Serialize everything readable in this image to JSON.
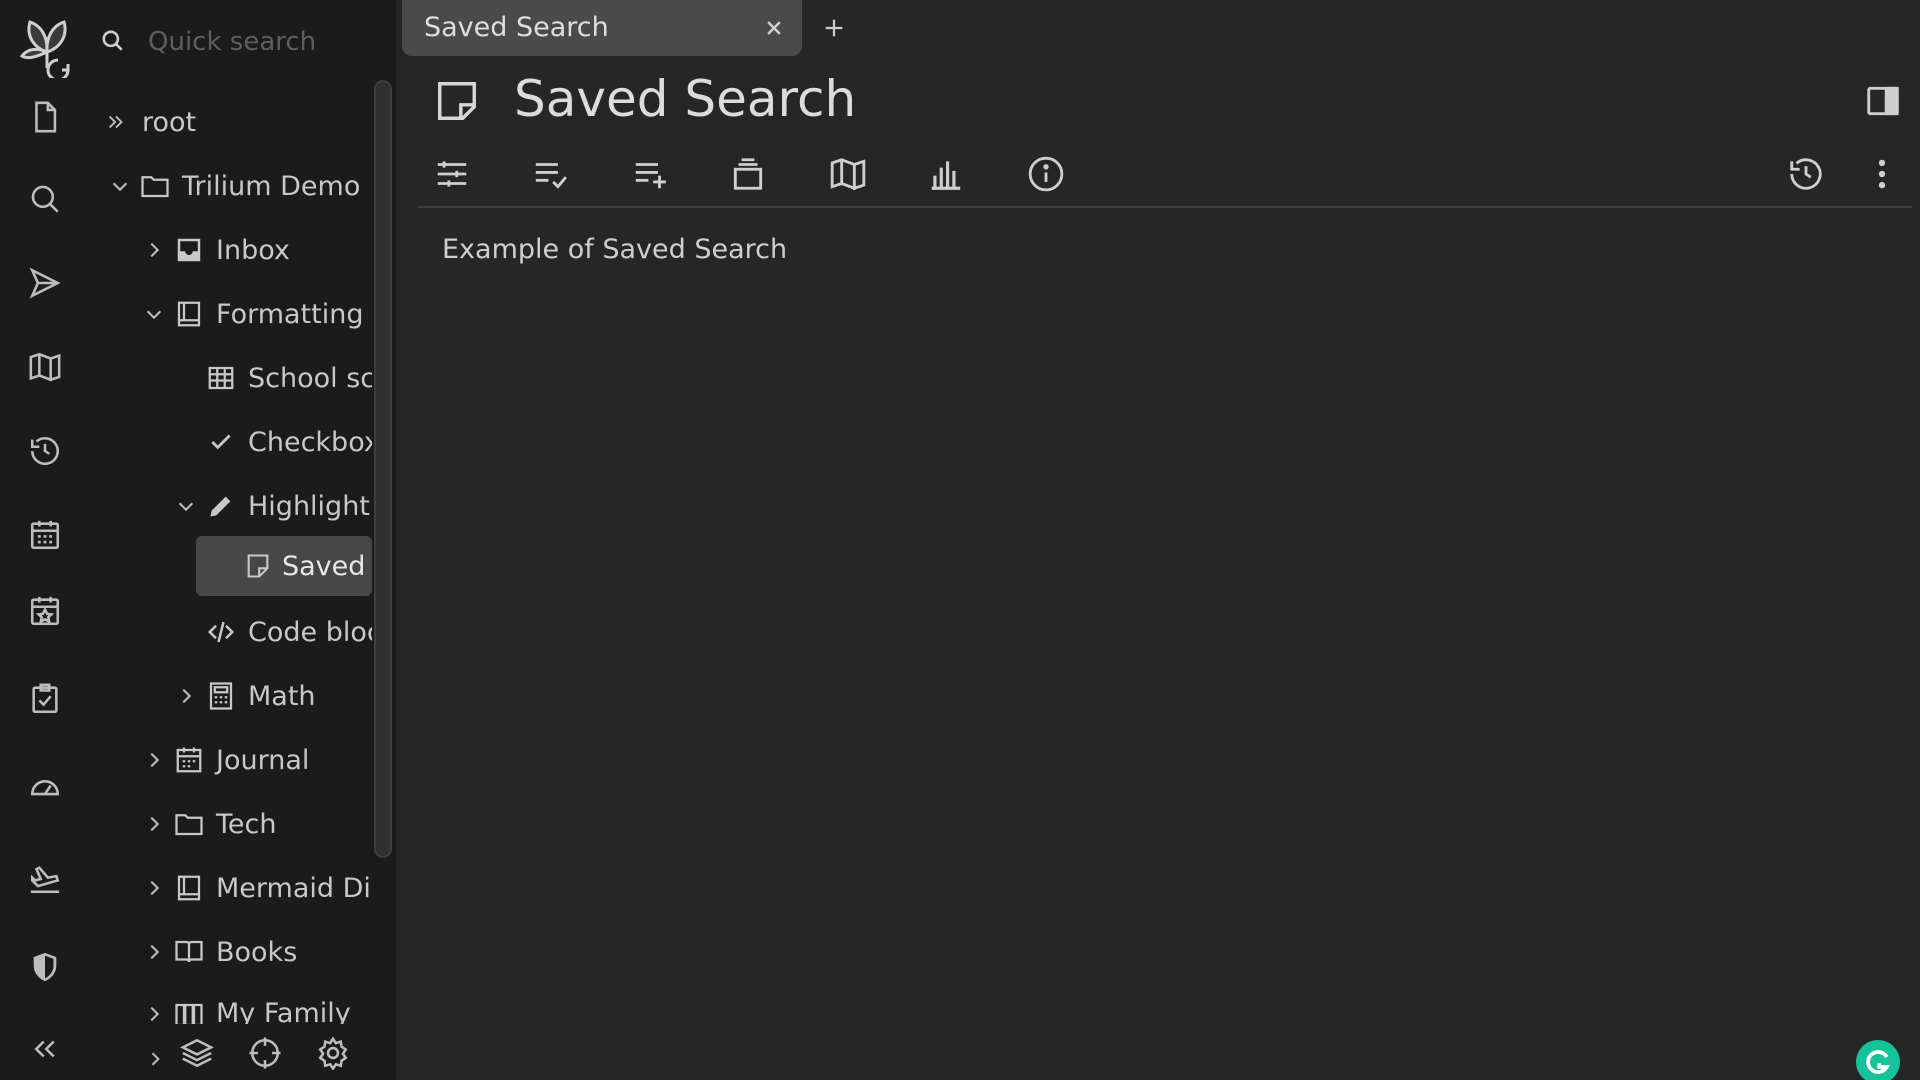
{
  "tree": {
    "search_placeholder": "Quick search",
    "root_label": "root",
    "nodes": [
      {
        "label": "Trilium Demo"
      },
      {
        "label": "Inbox"
      },
      {
        "label": "Formatting"
      },
      {
        "label": "School schedule"
      },
      {
        "label": "Checkbox"
      },
      {
        "label": "Highlighting"
      },
      {
        "label": "Saved Search"
      },
      {
        "label": "Code blocks"
      },
      {
        "label": "Math"
      },
      {
        "label": "Journal"
      },
      {
        "label": "Tech"
      },
      {
        "label": "Mermaid Diagrams"
      },
      {
        "label": "Books"
      },
      {
        "label": "My Family"
      }
    ]
  },
  "tab": {
    "title": "Saved Search"
  },
  "note": {
    "title": "Saved Search",
    "content": "Example of Saved Search"
  },
  "icons": {
    "launcher": [
      "new-note-icon",
      "search-icon",
      "send-icon",
      "map-icon",
      "history-icon",
      "calendar-icon",
      "calendar-star-icon",
      "task-icon",
      "dashboard-icon",
      "plane-icon",
      "shield-icon",
      "collapse-icon"
    ],
    "ribbon": [
      "options-icon",
      "search-params-icon",
      "add-list-icon",
      "stack-icon",
      "note-map-icon",
      "stats-icon",
      "info-icon"
    ]
  },
  "colors": {
    "background": "#262626",
    "sidebar": "#1b1b1b",
    "active_item": "#474747",
    "grammarly": "#15c39a"
  }
}
